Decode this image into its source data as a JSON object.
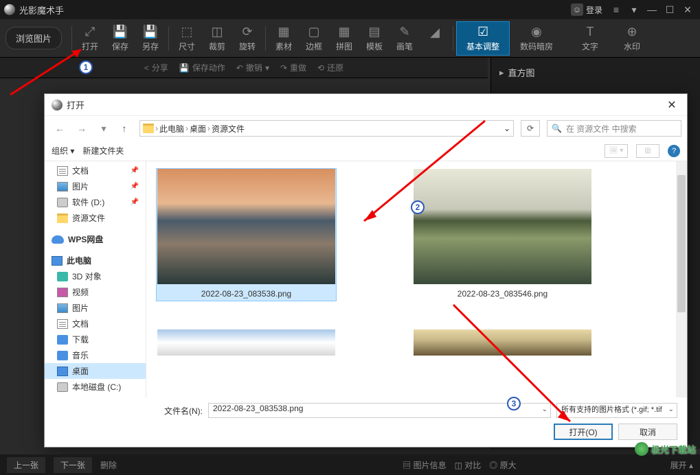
{
  "titlebar": {
    "title": "光影魔术手",
    "login": "登录"
  },
  "toolbar": {
    "browse": "浏览图片",
    "items": [
      {
        "icon": "⬚",
        "label": "打开"
      },
      {
        "icon": "⎘",
        "label": "保存"
      },
      {
        "icon": "⎘",
        "label": "另存"
      },
      {
        "icon": "⬚",
        "label": "尺寸"
      },
      {
        "icon": "✂",
        "label": "裁剪"
      },
      {
        "icon": "⟳",
        "label": "旋转"
      },
      {
        "icon": "▦",
        "label": "素材"
      },
      {
        "icon": "▢",
        "label": "边框"
      },
      {
        "icon": "▦",
        "label": "拼图"
      },
      {
        "icon": "▤",
        "label": "模板"
      },
      {
        "icon": "✎",
        "label": "画笔"
      },
      {
        "icon": "☑",
        "label": "基本调整"
      },
      {
        "icon": "◉",
        "label": "数码暗房"
      },
      {
        "icon": "T",
        "label": "文字"
      },
      {
        "icon": "⊕",
        "label": "水印"
      }
    ]
  },
  "subtoolbar": {
    "share": "分享",
    "save_action": "保存动作",
    "undo": "撤销",
    "redo": "重做",
    "restore": "还原"
  },
  "right_panel": {
    "histogram": "直方图"
  },
  "dialog": {
    "title": "打开",
    "breadcrumb": [
      "此电脑",
      "桌面",
      "资源文件"
    ],
    "search_placeholder": "在 资源文件 中搜索",
    "organize": "组织",
    "new_folder": "新建文件夹",
    "sidebar": [
      {
        "icon": "ic-doc",
        "label": "文档",
        "pin": true
      },
      {
        "icon": "ic-pic",
        "label": "图片",
        "pin": true
      },
      {
        "icon": "ic-disk",
        "label": "软件 (D:)",
        "pin": true
      },
      {
        "icon": "ic-folder",
        "label": "资源文件"
      },
      {
        "icon": "ic-cloud",
        "label": "WPS网盘",
        "head": true
      },
      {
        "icon": "ic-pc",
        "label": "此电脑",
        "head": true
      },
      {
        "icon": "ic-3d",
        "label": "3D 对象"
      },
      {
        "icon": "ic-video",
        "label": "视频"
      },
      {
        "icon": "ic-pic",
        "label": "图片"
      },
      {
        "icon": "ic-doc",
        "label": "文档"
      },
      {
        "icon": "ic-down",
        "label": "下载"
      },
      {
        "icon": "ic-music",
        "label": "音乐"
      },
      {
        "icon": "ic-desk",
        "label": "桌面",
        "selected": true
      },
      {
        "icon": "ic-disk",
        "label": "本地磁盘 (C:)"
      }
    ],
    "files": [
      {
        "name": "2022-08-23_083538.png",
        "selected": true,
        "thumb": "img1"
      },
      {
        "name": "2022-08-23_083546.png",
        "thumb": "img2"
      }
    ],
    "filename_label": "文件名(N):",
    "filename_value": "2022-08-23_083538.png",
    "filetype": "所有支持的图片格式 (*.gif; *.tif",
    "open_btn": "打开(O)",
    "cancel_btn": "取消"
  },
  "bottom": {
    "prev": "上一张",
    "next": "下一张",
    "delete": "删除",
    "info": "图片信息",
    "compare": "对比",
    "original": "原大",
    "expand": "展开"
  },
  "watermark": "极光下载站"
}
